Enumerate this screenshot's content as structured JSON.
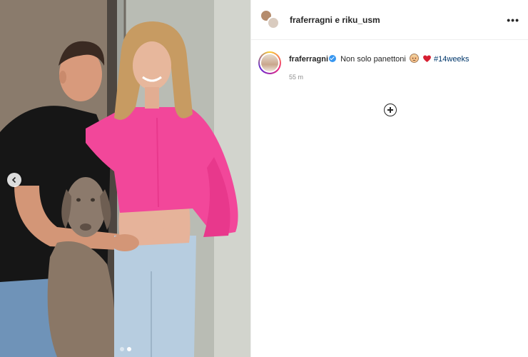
{
  "header": {
    "names": "fraferragni e riku_usm",
    "more_icon": "more-horizontal-icon"
  },
  "caption": {
    "username": "fraferragni",
    "text": "Non solo panettoni",
    "hashtag": "#14weeks",
    "time": "55 m",
    "emojis": [
      "baby-face-emoji",
      "red-heart-emoji"
    ]
  },
  "carousel": {
    "slide_count": 2,
    "active_index": 1
  },
  "colors": {
    "verified": "#3897f0",
    "hashtag": "#00376b",
    "sweater": "#f2479a"
  }
}
